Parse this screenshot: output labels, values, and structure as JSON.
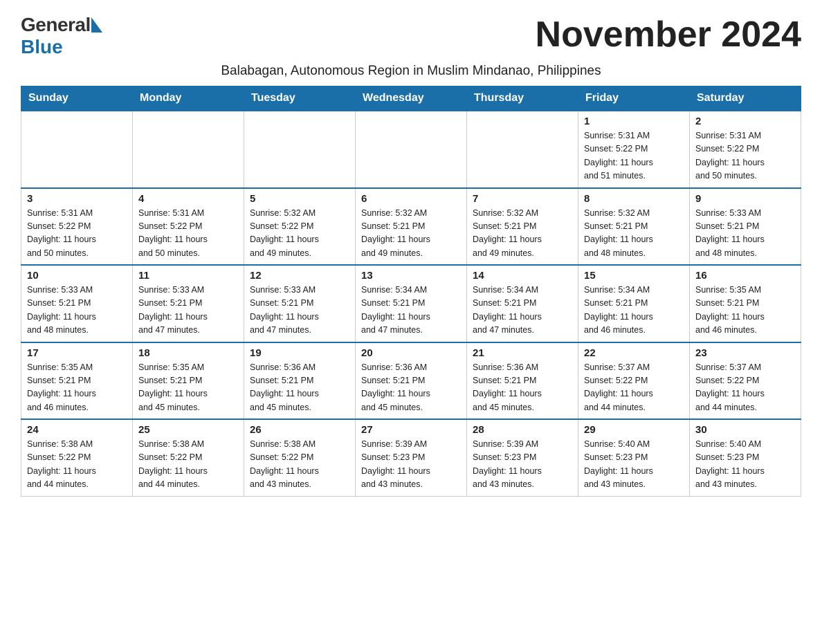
{
  "logo": {
    "general": "General",
    "blue": "Blue"
  },
  "header": {
    "title": "November 2024",
    "subtitle": "Balabagan, Autonomous Region in Muslim Mindanao, Philippines"
  },
  "weekdays": [
    "Sunday",
    "Monday",
    "Tuesday",
    "Wednesday",
    "Thursday",
    "Friday",
    "Saturday"
  ],
  "weeks": [
    [
      {
        "day": "",
        "info": ""
      },
      {
        "day": "",
        "info": ""
      },
      {
        "day": "",
        "info": ""
      },
      {
        "day": "",
        "info": ""
      },
      {
        "day": "",
        "info": ""
      },
      {
        "day": "1",
        "info": "Sunrise: 5:31 AM\nSunset: 5:22 PM\nDaylight: 11 hours\nand 51 minutes."
      },
      {
        "day": "2",
        "info": "Sunrise: 5:31 AM\nSunset: 5:22 PM\nDaylight: 11 hours\nand 50 minutes."
      }
    ],
    [
      {
        "day": "3",
        "info": "Sunrise: 5:31 AM\nSunset: 5:22 PM\nDaylight: 11 hours\nand 50 minutes."
      },
      {
        "day": "4",
        "info": "Sunrise: 5:31 AM\nSunset: 5:22 PM\nDaylight: 11 hours\nand 50 minutes."
      },
      {
        "day": "5",
        "info": "Sunrise: 5:32 AM\nSunset: 5:22 PM\nDaylight: 11 hours\nand 49 minutes."
      },
      {
        "day": "6",
        "info": "Sunrise: 5:32 AM\nSunset: 5:21 PM\nDaylight: 11 hours\nand 49 minutes."
      },
      {
        "day": "7",
        "info": "Sunrise: 5:32 AM\nSunset: 5:21 PM\nDaylight: 11 hours\nand 49 minutes."
      },
      {
        "day": "8",
        "info": "Sunrise: 5:32 AM\nSunset: 5:21 PM\nDaylight: 11 hours\nand 48 minutes."
      },
      {
        "day": "9",
        "info": "Sunrise: 5:33 AM\nSunset: 5:21 PM\nDaylight: 11 hours\nand 48 minutes."
      }
    ],
    [
      {
        "day": "10",
        "info": "Sunrise: 5:33 AM\nSunset: 5:21 PM\nDaylight: 11 hours\nand 48 minutes."
      },
      {
        "day": "11",
        "info": "Sunrise: 5:33 AM\nSunset: 5:21 PM\nDaylight: 11 hours\nand 47 minutes."
      },
      {
        "day": "12",
        "info": "Sunrise: 5:33 AM\nSunset: 5:21 PM\nDaylight: 11 hours\nand 47 minutes."
      },
      {
        "day": "13",
        "info": "Sunrise: 5:34 AM\nSunset: 5:21 PM\nDaylight: 11 hours\nand 47 minutes."
      },
      {
        "day": "14",
        "info": "Sunrise: 5:34 AM\nSunset: 5:21 PM\nDaylight: 11 hours\nand 47 minutes."
      },
      {
        "day": "15",
        "info": "Sunrise: 5:34 AM\nSunset: 5:21 PM\nDaylight: 11 hours\nand 46 minutes."
      },
      {
        "day": "16",
        "info": "Sunrise: 5:35 AM\nSunset: 5:21 PM\nDaylight: 11 hours\nand 46 minutes."
      }
    ],
    [
      {
        "day": "17",
        "info": "Sunrise: 5:35 AM\nSunset: 5:21 PM\nDaylight: 11 hours\nand 46 minutes."
      },
      {
        "day": "18",
        "info": "Sunrise: 5:35 AM\nSunset: 5:21 PM\nDaylight: 11 hours\nand 45 minutes."
      },
      {
        "day": "19",
        "info": "Sunrise: 5:36 AM\nSunset: 5:21 PM\nDaylight: 11 hours\nand 45 minutes."
      },
      {
        "day": "20",
        "info": "Sunrise: 5:36 AM\nSunset: 5:21 PM\nDaylight: 11 hours\nand 45 minutes."
      },
      {
        "day": "21",
        "info": "Sunrise: 5:36 AM\nSunset: 5:21 PM\nDaylight: 11 hours\nand 45 minutes."
      },
      {
        "day": "22",
        "info": "Sunrise: 5:37 AM\nSunset: 5:22 PM\nDaylight: 11 hours\nand 44 minutes."
      },
      {
        "day": "23",
        "info": "Sunrise: 5:37 AM\nSunset: 5:22 PM\nDaylight: 11 hours\nand 44 minutes."
      }
    ],
    [
      {
        "day": "24",
        "info": "Sunrise: 5:38 AM\nSunset: 5:22 PM\nDaylight: 11 hours\nand 44 minutes."
      },
      {
        "day": "25",
        "info": "Sunrise: 5:38 AM\nSunset: 5:22 PM\nDaylight: 11 hours\nand 44 minutes."
      },
      {
        "day": "26",
        "info": "Sunrise: 5:38 AM\nSunset: 5:22 PM\nDaylight: 11 hours\nand 43 minutes."
      },
      {
        "day": "27",
        "info": "Sunrise: 5:39 AM\nSunset: 5:23 PM\nDaylight: 11 hours\nand 43 minutes."
      },
      {
        "day": "28",
        "info": "Sunrise: 5:39 AM\nSunset: 5:23 PM\nDaylight: 11 hours\nand 43 minutes."
      },
      {
        "day": "29",
        "info": "Sunrise: 5:40 AM\nSunset: 5:23 PM\nDaylight: 11 hours\nand 43 minutes."
      },
      {
        "day": "30",
        "info": "Sunrise: 5:40 AM\nSunset: 5:23 PM\nDaylight: 11 hours\nand 43 minutes."
      }
    ]
  ]
}
